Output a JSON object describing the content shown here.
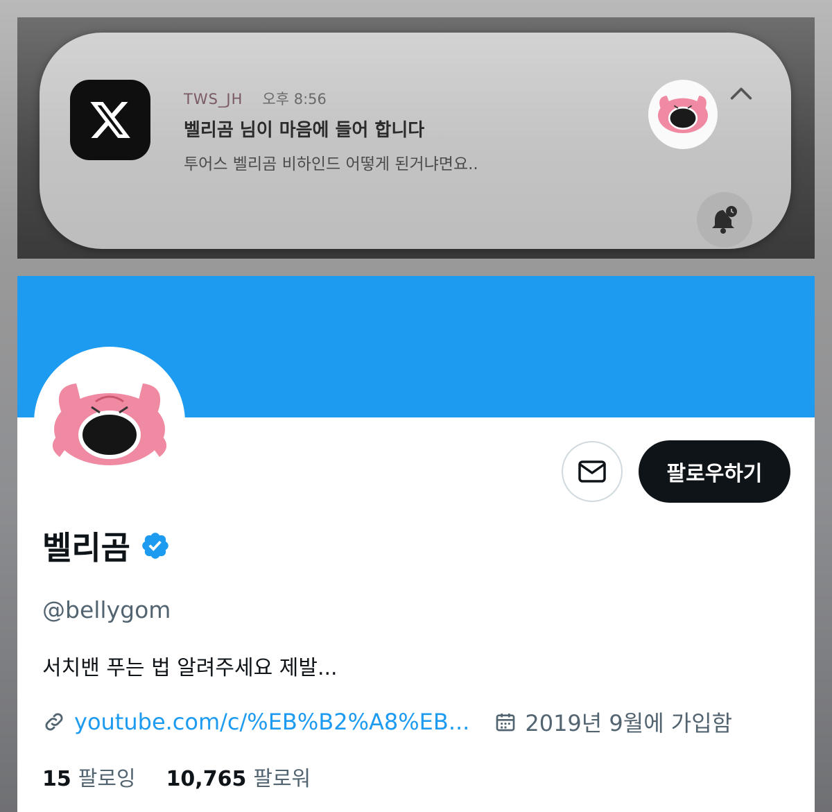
{
  "notification": {
    "app_icon": "x-logo-icon",
    "sender": "TWS_JH",
    "time": "오후 8:56",
    "title": "벨리곰 님이 마음에 들어 합니다",
    "body": "투어스 벨리곰 비하인드 어떻게 된거냐면요..",
    "avatar": "pink-bear-avatar",
    "collapse_icon": "chevron-up-icon",
    "bell_icon": "bell-snooze-icon"
  },
  "profile": {
    "banner_color": "#1d9bf0",
    "display_name": "벨리곰",
    "verified_icon": "verified-badge-icon",
    "handle": "@bellygom",
    "bio": "서치밴 푸는 법 알려주세요 제발...",
    "link_icon": "link-icon",
    "link": "youtube.com/c/%EB%B2%A8%EB...",
    "calendar_icon": "calendar-icon",
    "joined": "2019년 9월에 가입함",
    "message_icon": "envelope-icon",
    "follow_label": "팔로우하기",
    "following_count": "15",
    "following_label": "팔로잉",
    "followers_count": "10,765",
    "followers_label": "팔로워"
  }
}
